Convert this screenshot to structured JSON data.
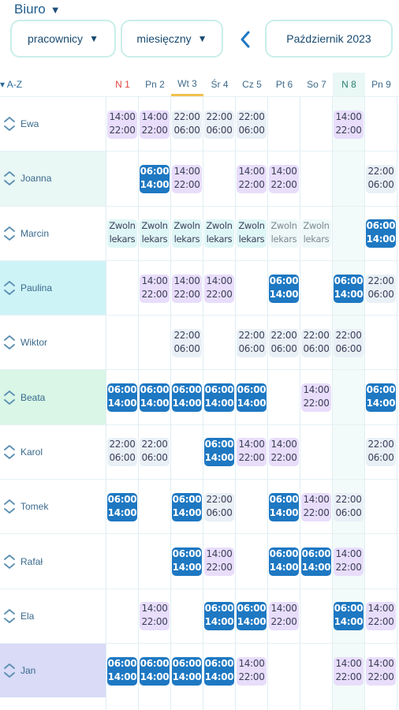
{
  "header": {
    "workplace": "Biuro",
    "filter_employees": "pracownicy",
    "filter_period": "miesięczny",
    "month_label": "Październik 2023"
  },
  "grid": {
    "sort_label": "A-Z",
    "days": [
      "N 1",
      "Pn 2",
      "Wt 3",
      "Śr 4",
      "Cz 5",
      "Pt 6",
      "So 7",
      "N 8",
      "Pn 9"
    ],
    "today_index": 2,
    "highlight_index": 7,
    "colors": {
      "shift_morning": "#1e78c2",
      "shift_afternoon": "#e8ddfb",
      "shift_night": "#e9f0f6",
      "leave": "#dff6f6",
      "sunday": "#e0453f",
      "today_underline": "#f2c14e"
    },
    "employees": [
      {
        "name": "Ewa",
        "bg": "#ffffff",
        "cells": [
          [
            "p",
            "14:00",
            "22:00"
          ],
          [
            "p",
            "14:00",
            "22:00"
          ],
          [
            "g",
            "22:00",
            "06:00"
          ],
          [
            "g",
            "22:00",
            "06:00"
          ],
          [
            "g",
            "22:00",
            "06:00"
          ],
          null,
          null,
          [
            "p",
            "14:00",
            "22:00"
          ],
          null
        ]
      },
      {
        "name": "Joanna",
        "bg": "#e9f7f5",
        "cells": [
          null,
          [
            "b",
            "06:00",
            "14:00"
          ],
          [
            "p",
            "14:00",
            "22:00"
          ],
          null,
          [
            "p",
            "14:00",
            "22:00"
          ],
          [
            "p",
            "14:00",
            "22:00"
          ],
          null,
          null,
          [
            "g",
            "22:00",
            "06:00"
          ]
        ]
      },
      {
        "name": "Marcin",
        "bg": "#ffffff",
        "cells": [
          [
            "l",
            "Zwoln",
            "lekars"
          ],
          [
            "l",
            "Zwoln",
            "lekars"
          ],
          [
            "l",
            "Zwoln",
            "lekars"
          ],
          [
            "l",
            "Zwoln",
            "lekars"
          ],
          [
            "l",
            "Zwoln",
            "lekars"
          ],
          [
            "d",
            "Zwoln",
            "lekars"
          ],
          [
            "d",
            "Zwoln",
            "lekars"
          ],
          null,
          [
            "b",
            "06:00",
            "14:00"
          ]
        ]
      },
      {
        "name": "Paulina",
        "bg": "#cdf3f7",
        "cells": [
          null,
          [
            "p",
            "14:00",
            "22:00"
          ],
          [
            "p",
            "14:00",
            "22:00"
          ],
          [
            "p",
            "14:00",
            "22:00"
          ],
          null,
          [
            "b",
            "06:00",
            "14:00"
          ],
          null,
          [
            "b",
            "06:00",
            "14:00"
          ],
          [
            "g",
            "22:00",
            "06:00"
          ]
        ]
      },
      {
        "name": "Wiktor",
        "bg": "#ffffff",
        "cells": [
          null,
          null,
          [
            "g",
            "22:00",
            "06:00"
          ],
          null,
          [
            "g",
            "22:00",
            "06:00"
          ],
          [
            "g",
            "22:00",
            "06:00"
          ],
          [
            "g",
            "22:00",
            "06:00"
          ],
          [
            "g",
            "22:00",
            "06:00"
          ],
          null
        ]
      },
      {
        "name": "Beata",
        "bg": "#d9f6e6",
        "cells": [
          [
            "b",
            "06:00",
            "14:00"
          ],
          [
            "b",
            "06:00",
            "14:00"
          ],
          [
            "b",
            "06:00",
            "14:00"
          ],
          [
            "b",
            "06:00",
            "14:00"
          ],
          [
            "b",
            "06:00",
            "14:00"
          ],
          null,
          [
            "p",
            "14:00",
            "22:00"
          ],
          null,
          [
            "b",
            "06:00",
            "14:00"
          ]
        ]
      },
      {
        "name": "Karol",
        "bg": "#ffffff",
        "cells": [
          [
            "g",
            "22:00",
            "06:00"
          ],
          [
            "g",
            "22:00",
            "06:00"
          ],
          null,
          [
            "b",
            "06:00",
            "14:00"
          ],
          [
            "p",
            "14:00",
            "22:00"
          ],
          [
            "p",
            "14:00",
            "22:00"
          ],
          null,
          null,
          [
            "g",
            "22:00",
            "06:00"
          ]
        ]
      },
      {
        "name": "Tomek",
        "bg": "#ffffff",
        "cells": [
          [
            "b",
            "06:00",
            "14:00"
          ],
          null,
          [
            "b",
            "06:00",
            "14:00"
          ],
          [
            "g",
            "22:00",
            "06:00"
          ],
          null,
          [
            "b",
            "06:00",
            "14:00"
          ],
          [
            "p",
            "14:00",
            "22:00"
          ],
          [
            "g",
            "22:00",
            "06:00"
          ],
          null
        ]
      },
      {
        "name": "Rafał",
        "bg": "#ffffff",
        "cells": [
          null,
          null,
          [
            "b",
            "06:00",
            "14:00"
          ],
          [
            "p",
            "14:00",
            "22:00"
          ],
          null,
          [
            "b",
            "06:00",
            "14:00"
          ],
          [
            "b",
            "06:00",
            "14:00"
          ],
          [
            "p",
            "14:00",
            "22:00"
          ],
          null
        ]
      },
      {
        "name": "Ela",
        "bg": "#ffffff",
        "cells": [
          null,
          [
            "p",
            "14:00",
            "22:00"
          ],
          null,
          [
            "b",
            "06:00",
            "14:00"
          ],
          [
            "b",
            "06:00",
            "14:00"
          ],
          [
            "p",
            "14:00",
            "22:00"
          ],
          null,
          [
            "b",
            "06:00",
            "14:00"
          ],
          [
            "p",
            "14:00",
            "22:00"
          ]
        ]
      },
      {
        "name": "Jan",
        "bg": "#d9dbf7",
        "cells": [
          [
            "b",
            "06:00",
            "14:00"
          ],
          [
            "b",
            "06:00",
            "14:00"
          ],
          [
            "b",
            "06:00",
            "14:00"
          ],
          [
            "b",
            "06:00",
            "14:00"
          ],
          [
            "p",
            "14:00",
            "22:00"
          ],
          null,
          null,
          [
            "p",
            "14:00",
            "22:00"
          ],
          [
            "p",
            "14:00",
            "22:00"
          ]
        ]
      }
    ]
  }
}
